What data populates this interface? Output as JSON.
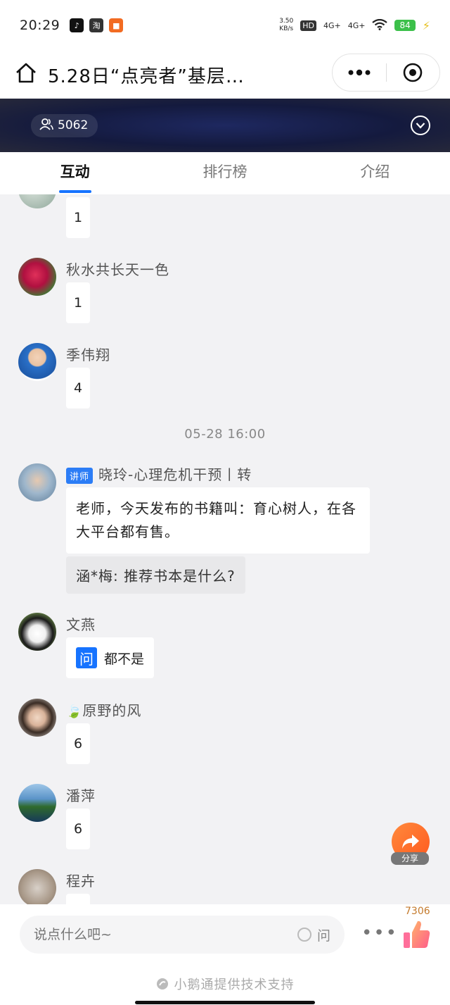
{
  "status_bar": {
    "time": "20:29",
    "net_speed_value": "3.50",
    "net_speed_unit": "KB/s",
    "hd": "HD",
    "signal1": "4G+",
    "signal2": "4G+",
    "battery": "84"
  },
  "header": {
    "title": "5.28日“点亮者”基层…"
  },
  "banner": {
    "viewer_count": "5062"
  },
  "tabs": [
    {
      "label": "互动",
      "active": true
    },
    {
      "label": "排行榜",
      "active": false
    },
    {
      "label": "介绍",
      "active": false
    }
  ],
  "feed": {
    "messages": [
      {
        "name": "",
        "text": "1"
      },
      {
        "name": "秋水共长天一色",
        "text": "1"
      },
      {
        "name": "季伟翔",
        "text": "4"
      }
    ],
    "timestamp": "05-28 16:00",
    "lecturer_message": {
      "badge": "讲师",
      "name": "晓玲-心理危机干预丨转",
      "text": "老师，今天发布的书籍叫：育心树人，在各大平台都有售。",
      "quote": "涵*梅: 推荐书本是什么?"
    },
    "question_message": {
      "name": "文燕",
      "badge": "问",
      "text": "都不是"
    },
    "later_messages": [
      {
        "name": "原野的风",
        "text": "6"
      },
      {
        "name": "潘萍",
        "text": "6"
      },
      {
        "name": "程卉",
        "text": ""
      }
    ]
  },
  "share": {
    "label": "分享"
  },
  "bottom_bar": {
    "input_placeholder": "说点什么吧~",
    "ask_label": "问",
    "more": "•••",
    "like_count": "7306",
    "powered_by": "小鹅通提供技术支持"
  }
}
